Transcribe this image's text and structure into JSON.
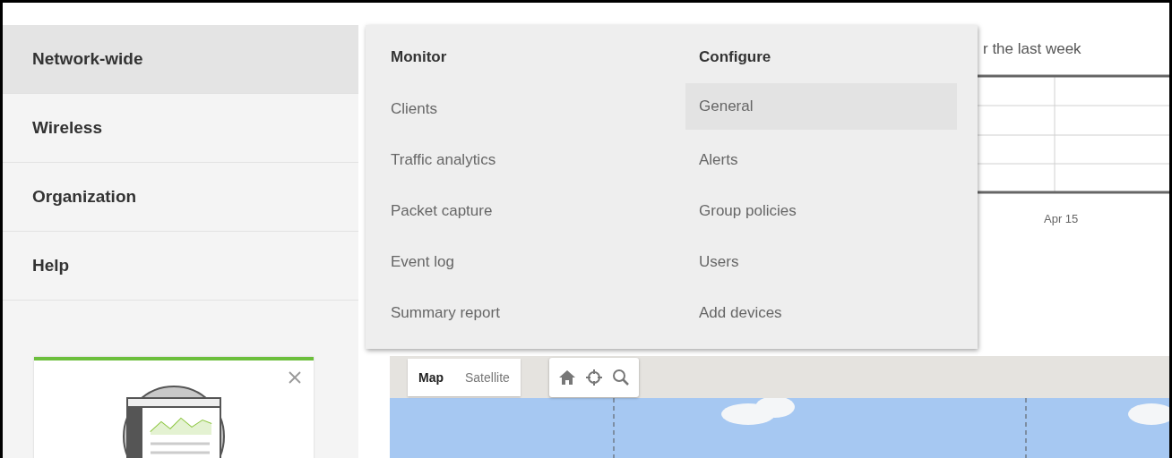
{
  "sidebar": {
    "items": [
      {
        "label": "Network-wide",
        "selected": true
      },
      {
        "label": "Wireless",
        "selected": false
      },
      {
        "label": "Organization",
        "selected": false
      },
      {
        "label": "Help",
        "selected": false
      }
    ]
  },
  "menu": {
    "columns": [
      {
        "heading": "Monitor",
        "items": [
          {
            "label": "Clients",
            "selected": false
          },
          {
            "label": "Traffic analytics",
            "selected": false
          },
          {
            "label": "Packet capture",
            "selected": false
          },
          {
            "label": "Event log",
            "selected": false
          },
          {
            "label": "Summary report",
            "selected": false
          }
        ]
      },
      {
        "heading": "Configure",
        "items": [
          {
            "label": "General",
            "selected": true
          },
          {
            "label": "Alerts",
            "selected": false
          },
          {
            "label": "Group policies",
            "selected": false
          },
          {
            "label": "Users",
            "selected": false
          },
          {
            "label": "Add devices",
            "selected": false
          }
        ]
      }
    ]
  },
  "chart_panel": {
    "heading": "r the last week",
    "x_label": "Apr 15"
  },
  "map": {
    "types": [
      {
        "label": "Map",
        "selected": true
      },
      {
        "label": "Satellite",
        "selected": false
      }
    ]
  }
}
